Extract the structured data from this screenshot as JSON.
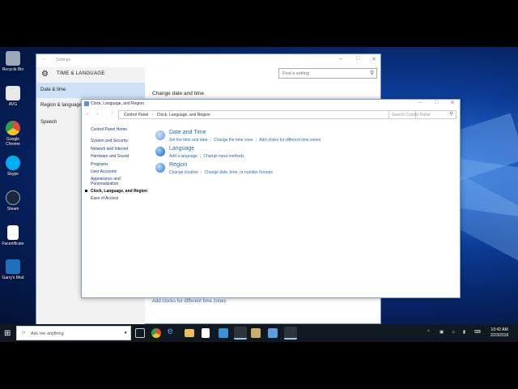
{
  "desktop": {
    "icons": [
      {
        "label": "Recycle Bin",
        "color": "#9aa8b8"
      },
      {
        "label": "AVG",
        "color": "#e8e8e8"
      },
      {
        "label": "Google Chrome",
        "color": "#e04a3a"
      },
      {
        "label": "Skype",
        "color": "#00aff0"
      },
      {
        "label": "Steam",
        "color": "#1b2838"
      },
      {
        "label": "Facertificate",
        "color": "#ffffff"
      },
      {
        "label": "Garry's Mod",
        "color": "#1f6fbf"
      }
    ]
  },
  "settings": {
    "title": "Settings",
    "header": "TIME & LANGUAGE",
    "search_placeholder": "Find a setting",
    "nav": [
      {
        "label": "Date & time",
        "selected": true
      },
      {
        "label": "Region & language",
        "selected": false
      },
      {
        "label": "Speech",
        "selected": false
      }
    ],
    "main_heading": "Change date and time",
    "bottom_link": "Add clocks for different time zones"
  },
  "control_panel": {
    "title": "Clock, Language, and Region",
    "breadcrumb": [
      "Control Panel",
      "Clock, Language, and Region"
    ],
    "search_placeholder": "Search Control Panel",
    "side_links": [
      "Control Panel Home",
      "System and Security",
      "Network and Internet",
      "Hardware and Sound",
      "Programs",
      "User Accounts",
      "Appearance and Personalization",
      "Clock, Language, and Region",
      "Ease of Access"
    ],
    "current": "Clock, Language, and Region",
    "categories": [
      {
        "title": "Date and Time",
        "links": [
          "Set the time and date",
          "Change the time zone",
          "Add clocks for different time zones"
        ],
        "color": "#5a9ee0"
      },
      {
        "title": "Language",
        "links": [
          "Add a language",
          "Change input methods"
        ],
        "color": "#3b7fd4"
      },
      {
        "title": "Region",
        "links": [
          "Change location",
          "Change date, time, or number formats"
        ],
        "color": "#4a8ed8"
      }
    ]
  },
  "taskbar": {
    "search_placeholder": "Ask me anything",
    "time": "10:42 AM",
    "date": "2/23/2016"
  }
}
